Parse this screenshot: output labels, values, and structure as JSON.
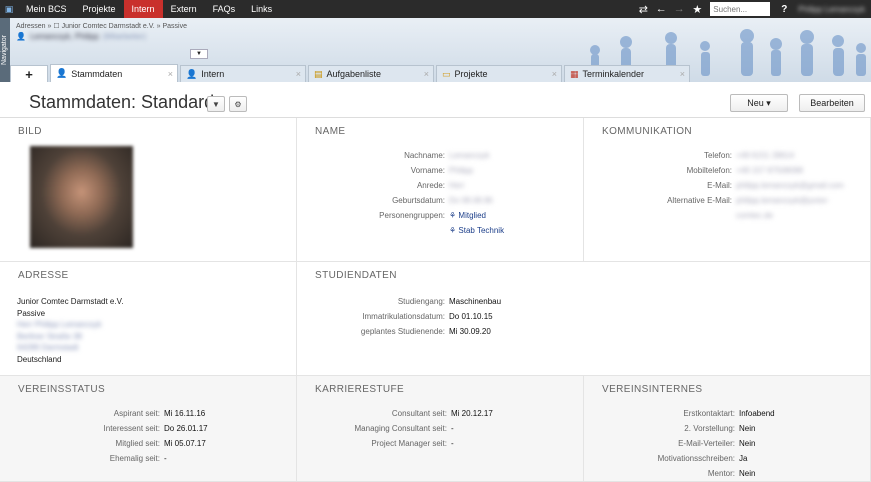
{
  "topbar": {
    "menu": [
      "Mein BCS",
      "Projekte",
      "Intern",
      "Extern",
      "FAQs",
      "Links"
    ],
    "active_menu": "Intern",
    "search_placeholder": "Suchen...",
    "help_label": "?",
    "user_name": "Philipp Lemancsyk"
  },
  "header": {
    "navigator_label": "Navigator",
    "breadcrumb": "Adressen  »  ☐ Junior Comtec Darmstadt e.V.  »  Passive",
    "person_name": "Lemancsyk, Philipp",
    "person_role": "(Mitarbeiter)"
  },
  "tabs": [
    {
      "label": "+",
      "icon": ""
    },
    {
      "label": "Stammdaten",
      "icon": "person-icon"
    },
    {
      "label": "Intern",
      "icon": "person-icon"
    },
    {
      "label": "Aufgabenliste",
      "icon": "tasklist-icon"
    },
    {
      "label": "Projekte",
      "icon": "folder-icon"
    },
    {
      "label": "Terminkalender",
      "icon": "calendar-icon"
    }
  ],
  "title_row": {
    "title": "Stammdaten: Standard",
    "new_label": "Neu ▾",
    "edit_label": "Bearbeiten"
  },
  "bild": {
    "heading": "BILD"
  },
  "name": {
    "heading": "NAME",
    "rows": [
      {
        "label": "Nachname:",
        "value": "Lemancsyk"
      },
      {
        "label": "Vorname:",
        "value": "Philipp"
      },
      {
        "label": "Anrede:",
        "value": "Herr"
      },
      {
        "label": "Geburtsdatum:",
        "value": "Do 08.08.96"
      },
      {
        "label": "Personengruppen:",
        "value": "Mitglied"
      },
      {
        "label": "",
        "value": "Stab Technik"
      }
    ]
  },
  "kommunikation": {
    "heading": "KOMMUNIKATION",
    "rows": [
      {
        "label": "Telefon:",
        "value": "+49 6151 28614"
      },
      {
        "label": "Mobiltelefon:",
        "value": "+49 157 87508098"
      },
      {
        "label": "E-Mail:",
        "value": "philipp.lemancsyk@gmail.com"
      },
      {
        "label": "Alternative E-Mail:",
        "value": "philipp.lemancsyk@junior-"
      },
      {
        "label": "",
        "value": "comtec.de"
      }
    ]
  },
  "adresse": {
    "heading": "ADRESSE",
    "lines": [
      "Junior Comtec Darmstadt e.V.",
      "Passive",
      "Herr Philipp Lemancsyk",
      "Berliner Straße 38",
      "64289 Darmstadt",
      "Deutschland"
    ]
  },
  "studiendaten": {
    "heading": "STUDIENDATEN",
    "rows": [
      {
        "label": "Studiengang:",
        "value": "Maschinenbau"
      },
      {
        "label": "Immatrikulationsdatum:",
        "value": "Do 01.10.15"
      },
      {
        "label": "geplantes Studienende:",
        "value": "Mi 30.09.20"
      }
    ]
  },
  "vereinsstatus": {
    "heading": "VEREINSSTATUS",
    "rows": [
      {
        "label": "Aspirant seit:",
        "value": "Mi 16.11.16"
      },
      {
        "label": "Interessent seit:",
        "value": "Do 26.01.17"
      },
      {
        "label": "Mitglied seit:",
        "value": "Mi 05.07.17"
      },
      {
        "label": "Ehemalig seit:",
        "value": "-"
      }
    ]
  },
  "karrierestufe": {
    "heading": "KARRIERESTUFE",
    "rows": [
      {
        "label": "Consultant seit:",
        "value": "Mi 20.12.17"
      },
      {
        "label": "Managing Consultant seit:",
        "value": "-"
      },
      {
        "label": "Project Manager seit:",
        "value": "-"
      }
    ]
  },
  "vereinsinternes": {
    "heading": "VEREINSINTERNES",
    "rows": [
      {
        "label": "Erstkontaktart:",
        "value": "Infoabend"
      },
      {
        "label": "2. Vorstellung:",
        "value": "Nein"
      },
      {
        "label": "E-Mail-Verteiler:",
        "value": "Nein"
      },
      {
        "label": "Motivationsschreiben:",
        "value": "Ja"
      },
      {
        "label": "Mentor:",
        "value": "Nein"
      }
    ]
  },
  "colors": {
    "menu_active": "#c9302c",
    "topbar": "#2b2b2b",
    "link": "#1d3f8a"
  }
}
